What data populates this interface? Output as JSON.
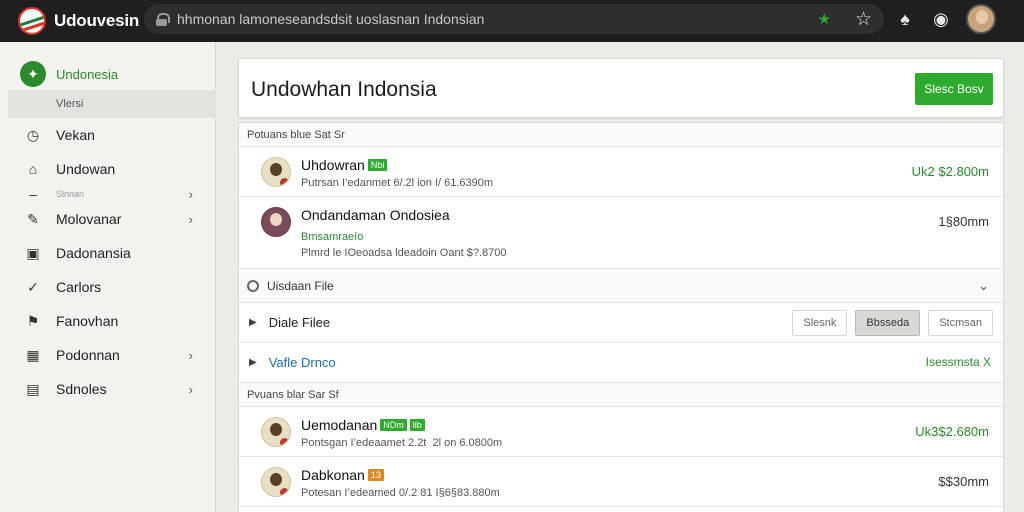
{
  "app": {
    "name": "Udouvesin",
    "url": "hhmonan lamoneseandsdsit uoslasnan Indonsian"
  },
  "sidebar": {
    "head": "Undonesia",
    "sub": "Vlersi",
    "items": [
      {
        "label": "Vekan",
        "icon": "clock-icon",
        "chevron": false
      },
      {
        "label": "Undowan",
        "icon": "home-icon",
        "chevron": false
      },
      {
        "label": "Slnnan",
        "icon": "",
        "chevron": true,
        "small": true
      },
      {
        "label": "Molovanar",
        "icon": "edit-icon",
        "chevron": true
      },
      {
        "label": "Dadonansia",
        "icon": "square-icon",
        "chevron": false
      },
      {
        "label": "Carlors",
        "icon": "check-circle-icon",
        "chevron": false
      },
      {
        "label": "Fanovhan",
        "icon": "flag-icon",
        "chevron": false
      },
      {
        "label": "Podonnan",
        "icon": "grid-icon",
        "chevron": true
      },
      {
        "label": "Sdnoles",
        "icon": "chart-icon",
        "chevron": true
      }
    ]
  },
  "header": {
    "title": "Undowhan Indonsia",
    "primary_button": "Slesc Bosv"
  },
  "section1": {
    "title": "Potuans blue Sat Sr"
  },
  "section2": {
    "title": "Pvuans blar Sar Sf"
  },
  "people1": [
    {
      "name": "Uhdowran",
      "tag": "Nbi",
      "meta": "Putrsan I’edanmet 6/.2l ion I/ 61.6390m",
      "amount": "Uk2 $2.800m"
    },
    {
      "name": "Ondandaman Ondosiea",
      "sub": "Bmsamraeío",
      "meta": "Plmrd le IOeoadsa ldeadoin Oant $?.8700",
      "amount": "1§80mm"
    }
  ],
  "file_row": {
    "label": "Uisdaan File"
  },
  "expand1": {
    "label": "Diale Filee",
    "buttons": [
      "Slesnk",
      "Bbsseda",
      "Stcmsan"
    ]
  },
  "expand2": {
    "label": "Vafle Drnco",
    "link": "Isessmsta X"
  },
  "people2": [
    {
      "name": "Uemodanan",
      "tag": "NDm",
      "tag2": "lib",
      "meta": "Pontsgan I’edeaamet 2.2t  2l on 6.0800m",
      "amount": "Uk3$2.680m"
    },
    {
      "name": "Dabkonan",
      "tag": "13",
      "meta": "Potesan I’edeamed 0/.2 81 I§6§83.880m",
      "amount": "$$30mm"
    }
  ],
  "colors": {
    "accent": "#2eab2e",
    "topbar": "#1f1f1f",
    "sidebar": "#f3f2ef"
  }
}
